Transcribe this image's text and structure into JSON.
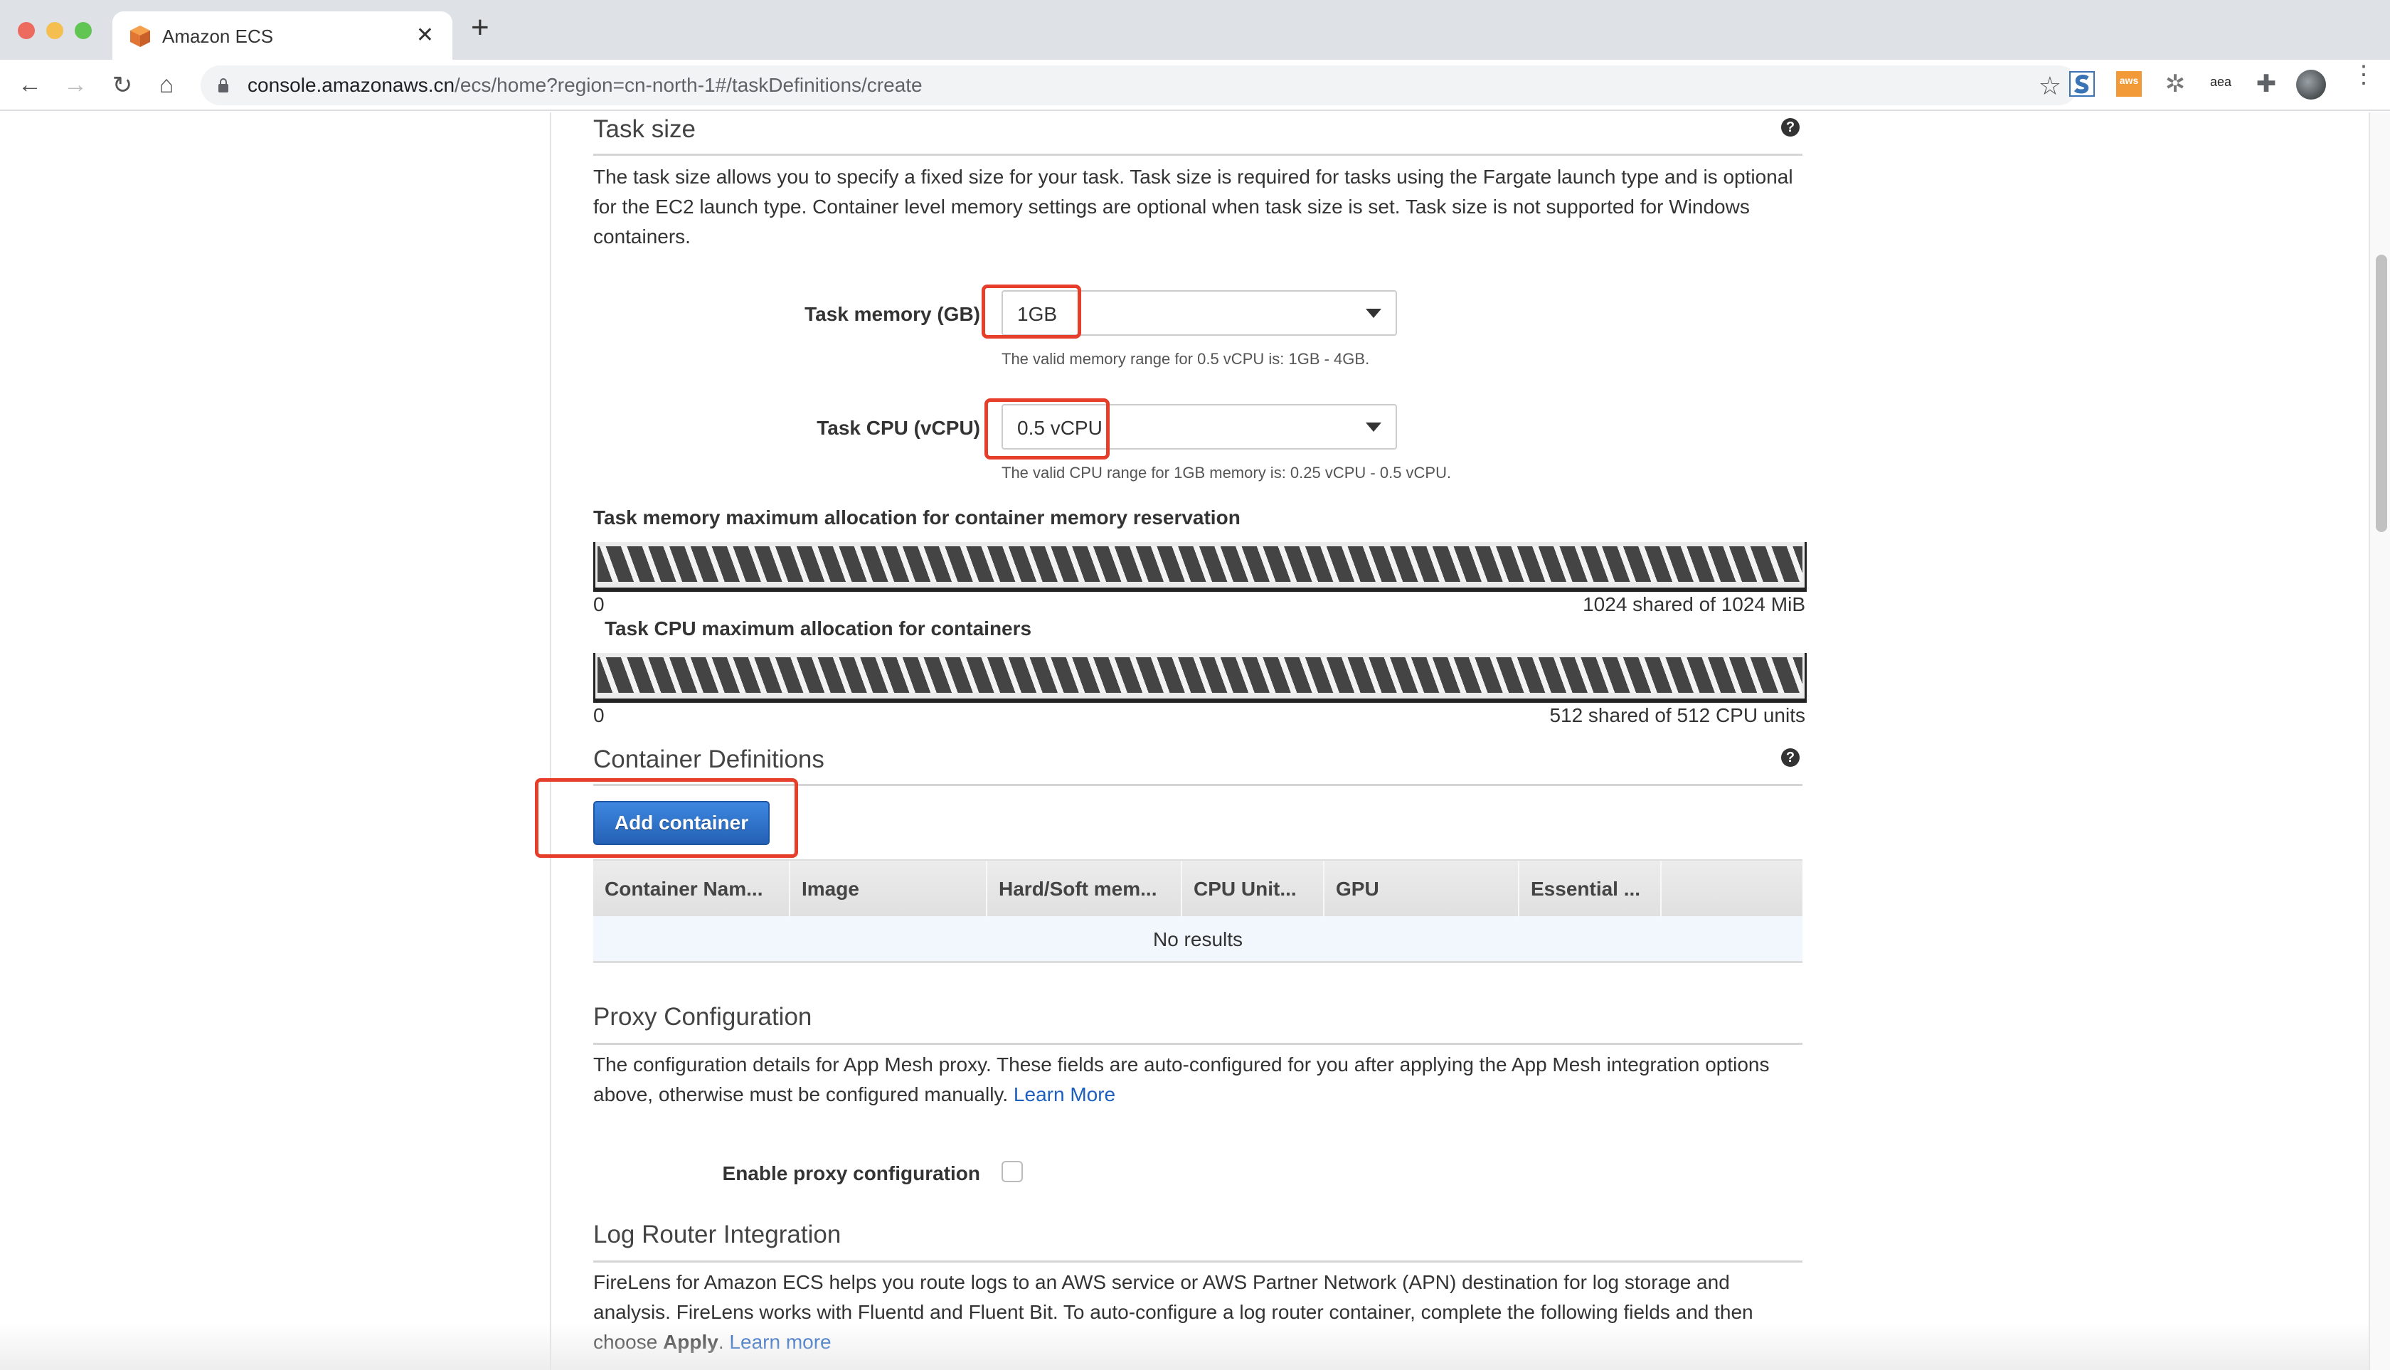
{
  "browser": {
    "tab": {
      "title": "Amazon ECS",
      "favicon": "aws-ecs-cube-icon",
      "close_glyph": "✕"
    },
    "new_tab_glyph": "+",
    "nav": {
      "back": "←",
      "forward": "→",
      "reload": "↻",
      "home": "⌂"
    },
    "url": {
      "host": "console.amazonaws.cn",
      "path": "/ecs/home?region=cn-north-1#/taskDefinitions/create"
    },
    "bookmark_glyph": "☆",
    "extensions": [
      {
        "name": "s-extension",
        "label": "S"
      },
      {
        "name": "aws-extension",
        "label": "aws"
      },
      {
        "name": "spinner-extension",
        "label": "✲"
      },
      {
        "name": "aea-extension",
        "label": "aea"
      },
      {
        "name": "extensions-puzzle",
        "label": "✚"
      }
    ],
    "menu_glyph": "⋮"
  },
  "task_size": {
    "title": "Task size",
    "help": "?",
    "description": "The task size allows you to specify a fixed size for your task. Task size is required for tasks using the Fargate launch type and is optional for the EC2 launch type. Container level memory settings are optional when task size is set. Task size is not supported for Windows containers.",
    "memory": {
      "label": "Task memory (GB)",
      "value": "1GB",
      "hint": "The valid memory range for 0.5 vCPU is: 1GB - 4GB."
    },
    "cpu": {
      "label": "Task CPU (vCPU)",
      "value": "0.5 vCPU",
      "hint": "The valid CPU range for 1GB memory is: 0.25 vCPU - 0.5 vCPU."
    },
    "memory_allocation": {
      "label": "Task memory maximum allocation for container memory reservation",
      "min": "0",
      "max_text": "1024 shared of 1024 MiB",
      "shared": 1024,
      "total": 1024,
      "fraction": 1.0
    },
    "cpu_allocation": {
      "label": "Task CPU maximum allocation for containers",
      "min": "0",
      "max_text": "512 shared of 512 CPU units",
      "shared": 512,
      "total": 512,
      "fraction": 1.0
    }
  },
  "container_definitions": {
    "title": "Container Definitions",
    "help": "?",
    "add_button": "Add container",
    "columns": [
      "Container Nam...",
      "Image",
      "Hard/Soft mem...",
      "CPU Unit...",
      "GPU",
      "Essential ...",
      ""
    ],
    "empty_text": "No results"
  },
  "proxy": {
    "title": "Proxy Configuration",
    "description": "The configuration details for App Mesh proxy. These fields are auto-configured for you after applying the App Mesh integration options above, otherwise must be configured manually.",
    "learn_more": "Learn More",
    "enable_label": "Enable proxy configuration",
    "enabled": false
  },
  "log_router": {
    "title": "Log Router Integration",
    "description_1": "FireLens for Amazon ECS helps you route logs to an AWS service or AWS Partner Network (APN) destination for log storage and analysis. FireLens works with Fluentd and Fluent Bit. To auto-configure a log router container, complete the following fields and then choose ",
    "apply_word": "Apply",
    "description_2": ". ",
    "learn_more": "Learn more"
  },
  "colors": {
    "highlight": "#e63e2a",
    "primary_button": "#2a6bc4",
    "link": "#1d5fbf"
  }
}
